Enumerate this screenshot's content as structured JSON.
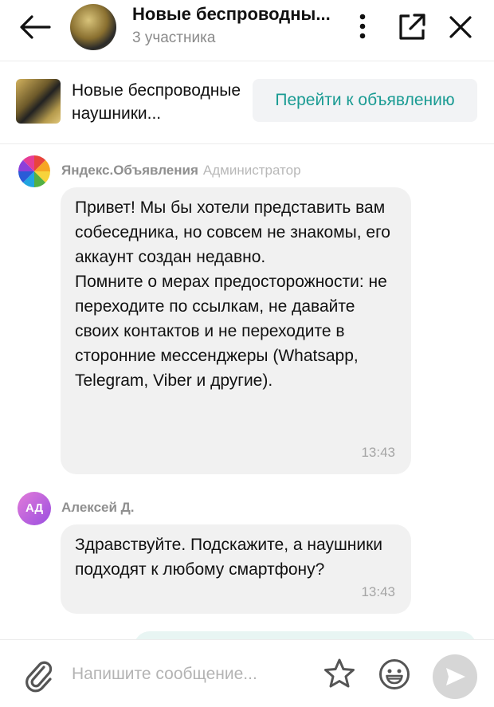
{
  "header": {
    "title": "Новые беспроводны...",
    "subtitle": "3 участника",
    "icons": {
      "back": "arrow-left-icon",
      "menu": "kebab-menu-icon",
      "open": "external-link-icon",
      "close": "close-icon"
    }
  },
  "listing": {
    "title": "Новые беспроводные наушники...",
    "button_label": "Перейти к объявлению"
  },
  "messages": [
    {
      "author": "Яндекс.Объявления",
      "role": "Администратор",
      "text": "Привет! Мы бы хотели представить вам собеседника, но совсем не знакомы, его аккаунт создан недавно.\nПомните о мерах предосторожности: не переходите по ссылкам, не давайте своих контактов и не переходите в сторонние мессенджеры (Whatsapp, Telegram, Viber и другие).",
      "time": "13:43"
    },
    {
      "author": "Алексей Д.",
      "initials": "АД",
      "text": "Здравствуйте. Подскажите, а наушники подходят к любому смартфону?",
      "time": "13:43"
    }
  ],
  "composer": {
    "placeholder": "Напишите сообщение...",
    "value": "",
    "icons": {
      "attach": "paperclip-icon",
      "favorite": "star-icon",
      "emoji": "emoji-icon",
      "send": "send-icon"
    }
  },
  "colors": {
    "accent": "#1a9b93",
    "bubble": "#f1f1f1",
    "send_disabled": "#d6d6d6",
    "avatar_ad": "#b565e0"
  }
}
